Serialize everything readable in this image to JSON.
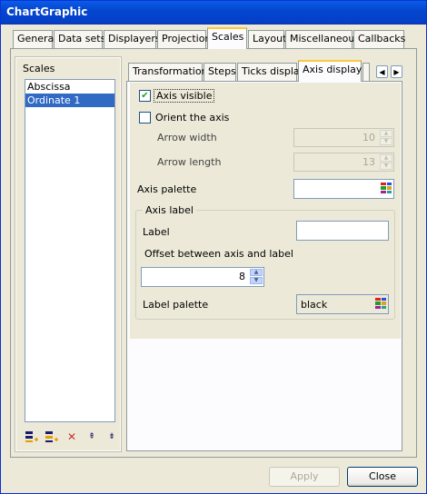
{
  "window": {
    "title": "ChartGraphic"
  },
  "main_tabs": [
    "General",
    "Data sets",
    "Displayers",
    "Projection",
    "Scales",
    "Layout",
    "Miscellaneous",
    "Callbacks"
  ],
  "scales": {
    "caption": "Scales",
    "items": [
      "Abscissa",
      "Ordinate 1"
    ],
    "selected": "Ordinate 1"
  },
  "sub_tabs": [
    "Transformation",
    "Steps",
    "Ticks display",
    "Axis display"
  ],
  "axis_display": {
    "axis_visible": {
      "label": "Axis visible",
      "checked": true
    },
    "orient_axis": {
      "label": "Orient the axis",
      "checked": false
    },
    "arrow_width": {
      "label": "Arrow width",
      "value": "10"
    },
    "arrow_length": {
      "label": "Arrow length",
      "value": "13"
    },
    "axis_palette": {
      "label": "Axis palette",
      "value": ""
    },
    "axis_label_group": {
      "legend": "Axis label",
      "label": {
        "label": "Label",
        "value": ""
      },
      "offset": {
        "label": "Offset between axis and label",
        "value": "8"
      },
      "label_palette": {
        "label": "Label palette",
        "value": "black"
      }
    }
  },
  "buttons": {
    "apply": "Apply",
    "close": "Close"
  },
  "icons": {
    "check": "✔",
    "scroll_left": "◀",
    "scroll_right": "▶",
    "spin_up": "▲",
    "spin_down": "▼",
    "delete": "✕",
    "move_up": "⇞",
    "move_down": "⇟"
  },
  "colors": {
    "titlebar": "#0546d0",
    "selection": "#316ac5",
    "tab_highlight": "#ffc83c"
  }
}
